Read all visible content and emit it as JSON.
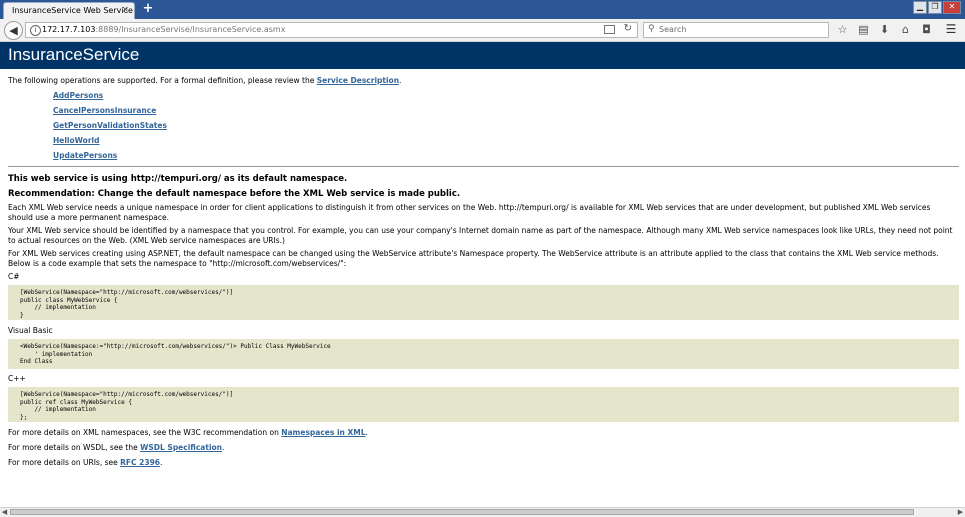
{
  "browser": {
    "tab_title": "InsuranceService Web Service",
    "tab_close": "×",
    "new_tab": "+",
    "url_host": "172.17.7.103",
    "url_rest": ":8889/InsuranceServise/InsuranceService.asmx",
    "search_placeholder": "Search",
    "window_buttons": [
      "▁",
      "❐",
      "✕"
    ]
  },
  "page": {
    "heading": "InsuranceService",
    "intro_prefix": "The following operations are supported. For a formal definition, please review the ",
    "intro_link": "Service Description",
    "intro_suffix": ".",
    "operations": [
      "AddPersons",
      "CancelPersonsInsurance",
      "GetPersonValidationStates",
      "HelloWorld",
      "UpdatePersons"
    ],
    "namespace_notice": "This web service is using http://tempuri.org/ as its default namespace.",
    "recommendation": "Recommendation: Change the default namespace before the XML Web service is made public.",
    "para1": "Each XML Web service needs a unique namespace in order for client applications to distinguish it from other services on the Web. http://tempuri.org/ is available for XML Web services that are under development, but published XML Web services should use a more permanent namespace.",
    "para2": "Your XML Web service should be identified by a namespace that you control. For example, you can use your company's Internet domain name as part of the namespace. Although many XML Web service namespaces look like URLs, they need not point to actual resources on the Web. (XML Web service namespaces are URIs.)",
    "para3": "For XML Web services creating using ASP.NET, the default namespace can be changed using the WebService attribute's Namespace property. The WebService attribute is an attribute applied to the class that contains the XML Web service methods. Below is a code example that sets the namespace to \"http://microsoft.com/webservices/\":",
    "lang_cs": "C#",
    "code_cs": "[WebService(Namespace=\"http://microsoft.com/webservices/\")]\npublic class MyWebService {\n    // implementation\n}",
    "lang_vb": "Visual Basic",
    "code_vb": "<WebService(Namespace:=\"http://microsoft.com/webservices/\")> Public Class MyWebService\n    ' implementation\nEnd Class",
    "lang_cpp": "C++",
    "code_cpp": "[WebService(Namespace=\"http://microsoft.com/webservices/\")]\npublic ref class MyWebService {\n    // implementation\n};",
    "more_xml_prefix": "For more details on XML namespaces, see the W3C recommendation on ",
    "more_xml_link": "Namespaces in XML",
    "more_wsdl_prefix": "For more details on WSDL, see the ",
    "more_wsdl_link": "WSDL Specification",
    "more_uri_prefix": "For more details on URIs, see ",
    "more_uri_link": "RFC 2396",
    "period": "."
  }
}
